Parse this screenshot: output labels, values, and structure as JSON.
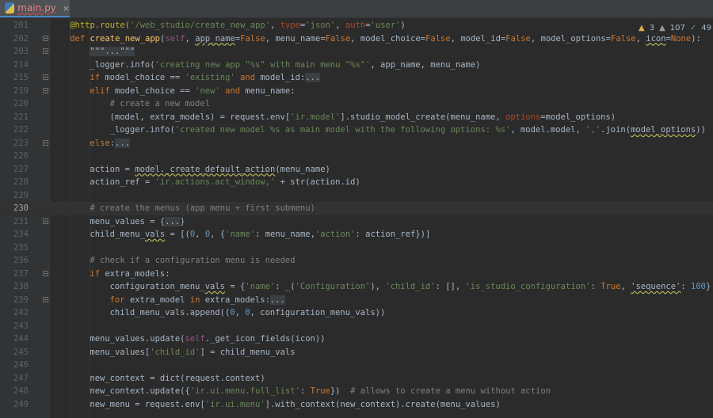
{
  "tab": {
    "filename": "main.py",
    "icon": "python-file-icon",
    "close": "×"
  },
  "inspections": {
    "warnings": "3",
    "weak_warnings": "107",
    "typos": "49"
  },
  "current_line": "230",
  "lines": [
    {
      "num": "201",
      "fold": false,
      "indent": 4,
      "tokens": [
        [
          "dec",
          "@http.route("
        ],
        [
          "st",
          "'/web_studio/create_new_app'"
        ],
        [
          "",
          ","
        ],
        [
          "par",
          " type"
        ],
        [
          "",
          "="
        ],
        [
          "st",
          "'json'"
        ],
        [
          "",
          ", "
        ],
        [
          "par",
          "auth"
        ],
        [
          "",
          "="
        ],
        [
          "st",
          "'user'"
        ],
        [
          "",
          ")"
        ]
      ]
    },
    {
      "num": "202",
      "fold": true,
      "indent": 4,
      "tokens": [
        [
          "kw",
          "def "
        ],
        [
          "fn",
          "create_new_app"
        ],
        [
          "",
          "("
        ],
        [
          "slf",
          "self"
        ],
        [
          "",
          ", "
        ],
        [
          "wavy",
          "app_name"
        ],
        [
          "",
          "="
        ],
        [
          "kw",
          "False"
        ],
        [
          "",
          ", menu_name="
        ],
        [
          "kw",
          "False"
        ],
        [
          "",
          ", model_choice="
        ],
        [
          "kw",
          "False"
        ],
        [
          "",
          ", model_id="
        ],
        [
          "kw",
          "False"
        ],
        [
          "",
          ", model_options="
        ],
        [
          "kw",
          "False"
        ],
        [
          "",
          ", "
        ],
        [
          "wavy",
          "icon"
        ],
        [
          "",
          "="
        ],
        [
          "kw",
          "None"
        ],
        [
          "",
          "):"
        ]
      ]
    },
    {
      "num": "203",
      "fold": true,
      "indent": 8,
      "tokens": [
        [
          "fd",
          "\"\"\"...\"\"\""
        ]
      ]
    },
    {
      "num": "214",
      "fold": false,
      "indent": 8,
      "tokens": [
        [
          "",
          "_logger.info("
        ],
        [
          "st",
          "'creating new app \"%s\" with main menu \"%s\"'"
        ],
        [
          "",
          ", app_name, menu_name)"
        ]
      ]
    },
    {
      "num": "215",
      "fold": true,
      "indent": 8,
      "tokens": [
        [
          "kw",
          "if "
        ],
        [
          "",
          "model_choice == "
        ],
        [
          "st",
          "'existing'"
        ],
        [
          "kw",
          " and "
        ],
        [
          "",
          "model_id:"
        ],
        [
          "fd",
          "..."
        ]
      ]
    },
    {
      "num": "219",
      "fold": true,
      "indent": 8,
      "tokens": [
        [
          "kw",
          "elif "
        ],
        [
          "",
          "model_choice == "
        ],
        [
          "st",
          "'new'"
        ],
        [
          "kw",
          " and "
        ],
        [
          "",
          "menu_name:"
        ]
      ]
    },
    {
      "num": "220",
      "fold": false,
      "indent": 12,
      "tokens": [
        [
          "cm",
          "# create a new model"
        ]
      ]
    },
    {
      "num": "221",
      "fold": false,
      "indent": 12,
      "tokens": [
        [
          "",
          "(model, extra_models) = request.env["
        ],
        [
          "st",
          "'ir.model'"
        ],
        [
          "",
          "].studio_model_create(menu_name, "
        ],
        [
          "par",
          "options"
        ],
        [
          "",
          "=model_options)"
        ]
      ]
    },
    {
      "num": "222",
      "fold": false,
      "indent": 12,
      "tokens": [
        [
          "",
          "_logger.info("
        ],
        [
          "st",
          "'created new model %s as main model with the following options: %s'"
        ],
        [
          "",
          ", model.model, "
        ],
        [
          "st",
          "','"
        ],
        [
          "",
          ".join("
        ],
        [
          "wavy",
          "model_options"
        ],
        [
          "",
          "))"
        ]
      ]
    },
    {
      "num": "223",
      "fold": true,
      "indent": 8,
      "tokens": [
        [
          "kw",
          "else"
        ],
        [
          "",
          ":"
        ],
        [
          "fd",
          "..."
        ]
      ]
    },
    {
      "num": "226",
      "fold": false,
      "indent": 0,
      "tokens": []
    },
    {
      "num": "227",
      "fold": false,
      "indent": 8,
      "tokens": [
        [
          "",
          "action = "
        ],
        [
          "wavy",
          "model._create_default_action"
        ],
        [
          "",
          "(menu_name)"
        ]
      ]
    },
    {
      "num": "228",
      "fold": false,
      "indent": 8,
      "tokens": [
        [
          "",
          "action_ref = "
        ],
        [
          "st",
          "'ir.actions.act_window,'"
        ],
        [
          "",
          " + str(action.id)"
        ]
      ]
    },
    {
      "num": "229",
      "fold": false,
      "indent": 0,
      "tokens": []
    },
    {
      "num": "230",
      "fold": false,
      "indent": 8,
      "tokens": [
        [
          "cm",
          "# create the menus (app menu + first submenu)"
        ]
      ]
    },
    {
      "num": "231",
      "fold": true,
      "indent": 8,
      "tokens": [
        [
          "",
          "menu_values = {"
        ],
        [
          "fd",
          "..."
        ],
        [
          "",
          "}"
        ]
      ]
    },
    {
      "num": "234",
      "fold": false,
      "indent": 8,
      "tokens": [
        [
          "",
          "child_menu_"
        ],
        [
          "wavy",
          "vals"
        ],
        [
          "",
          " = [("
        ],
        [
          "num",
          "0"
        ],
        [
          "",
          ", "
        ],
        [
          "num",
          "0"
        ],
        [
          "",
          ", {"
        ],
        [
          "st",
          "'name'"
        ],
        [
          "",
          ": menu_name,"
        ],
        [
          "st",
          "'action'"
        ],
        [
          "",
          ": action_ref})]"
        ]
      ]
    },
    {
      "num": "235",
      "fold": false,
      "indent": 0,
      "tokens": []
    },
    {
      "num": "236",
      "fold": false,
      "indent": 8,
      "tokens": [
        [
          "cm",
          "# check if a configuration menu is needed"
        ]
      ]
    },
    {
      "num": "237",
      "fold": true,
      "indent": 8,
      "tokens": [
        [
          "kw",
          "if "
        ],
        [
          "",
          "extra_models:"
        ]
      ]
    },
    {
      "num": "238",
      "fold": false,
      "indent": 12,
      "tokens": [
        [
          "",
          "configuration_menu_"
        ],
        [
          "wavy",
          "vals"
        ],
        [
          "",
          " = {"
        ],
        [
          "st",
          "'name'"
        ],
        [
          "",
          ": _("
        ],
        [
          "st",
          "'Configuration'"
        ],
        [
          "",
          "), "
        ],
        [
          "st",
          "'child_id'"
        ],
        [
          "",
          ": [], "
        ],
        [
          "st",
          "'is_studio_configuration'"
        ],
        [
          "",
          ": "
        ],
        [
          "kw",
          "True"
        ],
        [
          "",
          ", "
        ],
        [
          "wavy",
          "'sequence'"
        ],
        [
          "",
          ": "
        ],
        [
          "num",
          "100"
        ],
        [
          "",
          "}"
        ]
      ]
    },
    {
      "num": "239",
      "fold": true,
      "indent": 12,
      "tokens": [
        [
          "kw",
          "for "
        ],
        [
          "",
          "extra_model "
        ],
        [
          "kw",
          "in "
        ],
        [
          "",
          "extra_models:"
        ],
        [
          "fd",
          "..."
        ]
      ]
    },
    {
      "num": "242",
      "fold": false,
      "indent": 12,
      "tokens": [
        [
          "",
          "child_menu_vals.append(("
        ],
        [
          "num",
          "0"
        ],
        [
          "",
          ", "
        ],
        [
          "num",
          "0"
        ],
        [
          "",
          ", configuration_menu_vals))"
        ]
      ]
    },
    {
      "num": "243",
      "fold": false,
      "indent": 0,
      "tokens": []
    },
    {
      "num": "244",
      "fold": false,
      "indent": 8,
      "tokens": [
        [
          "",
          "menu_values.update("
        ],
        [
          "slf",
          "self"
        ],
        [
          "",
          "._get_icon_fields(icon))"
        ]
      ]
    },
    {
      "num": "245",
      "fold": false,
      "indent": 8,
      "tokens": [
        [
          "",
          "menu_values["
        ],
        [
          "st",
          "'child_id'"
        ],
        [
          "",
          "] = child_menu_vals"
        ]
      ]
    },
    {
      "num": "246",
      "fold": false,
      "indent": 0,
      "tokens": []
    },
    {
      "num": "247",
      "fold": false,
      "indent": 8,
      "tokens": [
        [
          "",
          "new_context = dict(request.context)"
        ]
      ]
    },
    {
      "num": "248",
      "fold": false,
      "indent": 8,
      "tokens": [
        [
          "",
          "new_context.update({"
        ],
        [
          "st",
          "'ir.ui.menu.full_list'"
        ],
        [
          "",
          ": "
        ],
        [
          "kw",
          "True"
        ],
        [
          "",
          "})  "
        ],
        [
          "cm",
          "# allows to create a menu without action"
        ]
      ]
    },
    {
      "num": "249",
      "fold": false,
      "indent": 8,
      "tokens": [
        [
          "",
          "new_menu = request.env["
        ],
        [
          "st",
          "'ir.ui.menu'"
        ],
        [
          "",
          "].with_context(new_context).create(menu_values)"
        ]
      ]
    }
  ]
}
